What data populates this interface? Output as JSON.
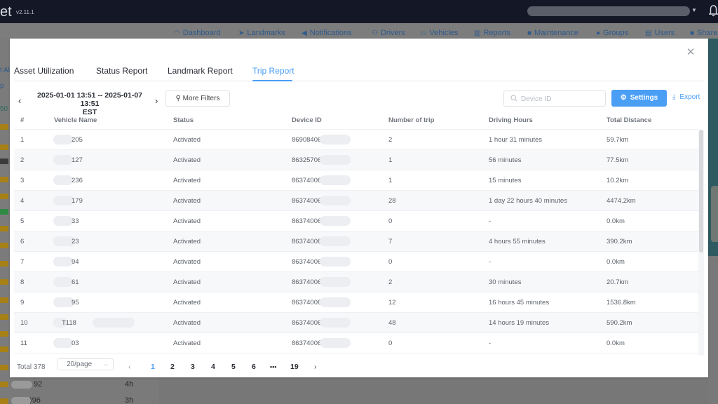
{
  "app": {
    "brand_fragment": "et",
    "version": "v2.11.1"
  },
  "nav": [
    {
      "label": "Dashboard",
      "icon": "dashboard-icon",
      "glyph": "◠"
    },
    {
      "label": "Landmarks",
      "icon": "location-arrow-icon",
      "glyph": "➤"
    },
    {
      "label": "Notifications",
      "icon": "megaphone-icon",
      "glyph": "◀"
    },
    {
      "label": "Drivers",
      "icon": "driver-icon",
      "glyph": "⚇"
    },
    {
      "label": "Vehicles",
      "icon": "vehicle-icon",
      "glyph": "▭"
    },
    {
      "label": "Reports",
      "icon": "reports-chart-icon",
      "glyph": "▥"
    },
    {
      "label": "Maintenance",
      "icon": "calendar-icon",
      "glyph": "■"
    },
    {
      "label": "Groups",
      "icon": "groups-icon",
      "glyph": "●"
    },
    {
      "label": "Users",
      "icon": "users-icon",
      "glyph": "▤"
    },
    {
      "label": "Share",
      "icon": "share-folder-icon",
      "glyph": "■"
    }
  ],
  "background": {
    "left_labels": [
      "t Al",
      "p",
      "50"
    ],
    "rows": [
      {
        "name_suffix": "92",
        "duration": "4h"
      },
      {
        "name_suffix": ")96",
        "duration": "3h"
      }
    ]
  },
  "modal": {
    "tabs": [
      {
        "label": "Asset Utilization",
        "active": false
      },
      {
        "label": "Status Report",
        "active": false
      },
      {
        "label": "Landmark Report",
        "active": false
      },
      {
        "label": "Trip Report",
        "active": true
      }
    ],
    "date_range_line1": "2025-01-01 13:51 -- 2025-01-07 13:51",
    "date_range_line2": "EST",
    "more_filters_label": "More Filters",
    "search_placeholder": "Device ID",
    "search_value": "",
    "settings_label": "Settings",
    "export_label": "Export",
    "columns": [
      "#",
      "Vehicle Name",
      "Status",
      "Device ID",
      "Number of trip",
      "Driving Hours",
      "Total Distance"
    ],
    "rows": [
      {
        "num": "1",
        "vehicle": "205",
        "status": "Activated",
        "device": "86908406",
        "trips": "2",
        "hours": "1 hour 31 minutes",
        "distance": "59.7km"
      },
      {
        "num": "2",
        "vehicle": "127",
        "status": "Activated",
        "device": "86325706",
        "trips": "1",
        "hours": "56 minutes",
        "distance": "77.5km"
      },
      {
        "num": "3",
        "vehicle": "236",
        "status": "Activated",
        "device": "86374006",
        "trips": "1",
        "hours": "15 minutes",
        "distance": "10.2km"
      },
      {
        "num": "4",
        "vehicle": "179",
        "status": "Activated",
        "device": "86374006",
        "trips": "28",
        "hours": "1 day 22 hours 40 minutes",
        "distance": "4474.2km"
      },
      {
        "num": "5",
        "vehicle": "33",
        "status": "Activated",
        "device": "86374006",
        "trips": "0",
        "hours": "-",
        "distance": "0.0km"
      },
      {
        "num": "6",
        "vehicle": "23",
        "status": "Activated",
        "device": "86374006",
        "trips": "7",
        "hours": "4 hours 55 minutes",
        "distance": "390.2km"
      },
      {
        "num": "7",
        "vehicle": "94",
        "status": "Activated",
        "device": "86374006",
        "trips": "0",
        "hours": "-",
        "distance": "0.0km"
      },
      {
        "num": "8",
        "vehicle": "61",
        "status": "Activated",
        "device": "86374006",
        "trips": "2",
        "hours": "30 minutes",
        "distance": "20.7km"
      },
      {
        "num": "9",
        "vehicle": "95",
        "status": "Activated",
        "device": "86374006",
        "trips": "12",
        "hours": "16 hours 45 minutes",
        "distance": "1536.8km"
      },
      {
        "num": "10",
        "vehicle": "T118",
        "status": "Activated",
        "device": "86374006",
        "trips": "48",
        "hours": "14 hours 19 minutes",
        "distance": "590.2km"
      },
      {
        "num": "11",
        "vehicle": "03",
        "status": "Activated",
        "device": "86374006",
        "trips": "0",
        "hours": "-",
        "distance": "0.0km"
      }
    ],
    "pagination": {
      "total_label": "Total 378",
      "page_size": "20/page",
      "pages": [
        "1",
        "2",
        "3",
        "4",
        "5",
        "6",
        "•••",
        "19"
      ],
      "current_page": "1"
    }
  },
  "colors": {
    "accent": "#4a9ff5",
    "topbar": "#141826"
  }
}
